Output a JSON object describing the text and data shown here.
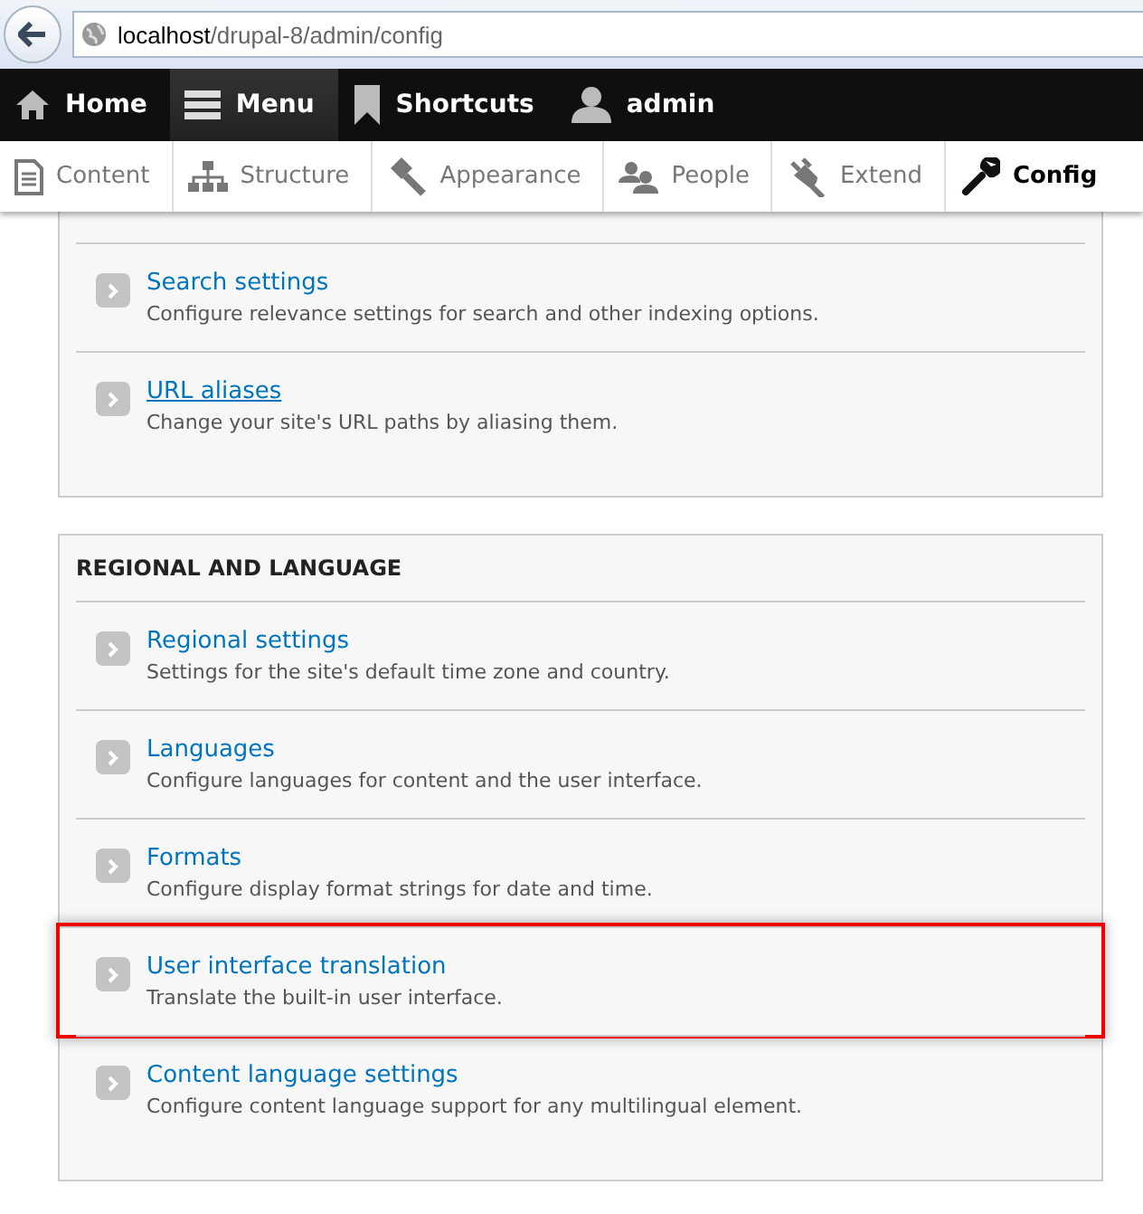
{
  "address_bar": {
    "host": "localhost",
    "path": "/drupal-8/admin/config"
  },
  "toolbar": [
    {
      "kind": "home",
      "label": "Home",
      "selected": false
    },
    {
      "kind": "menu",
      "label": "Menu",
      "selected": true
    },
    {
      "kind": "shortcuts",
      "label": "Shortcuts",
      "selected": false
    },
    {
      "kind": "user",
      "label": "admin",
      "selected": false
    }
  ],
  "tray": [
    {
      "kind": "content",
      "label": "Content",
      "selected": false
    },
    {
      "kind": "structure",
      "label": "Structure",
      "selected": false
    },
    {
      "kind": "appearance",
      "label": "Appearance",
      "selected": false
    },
    {
      "kind": "people",
      "label": "People",
      "selected": false
    },
    {
      "kind": "extend",
      "label": "Extend",
      "selected": false
    },
    {
      "kind": "config",
      "label": "Config",
      "selected": true
    }
  ],
  "panels": [
    {
      "items": [
        {
          "title": "Search settings",
          "description": "Configure relevance settings for search and other indexing options.",
          "hovered": false,
          "highlighted": false
        },
        {
          "title": "URL aliases",
          "description": "Change your site's URL paths by aliasing them.",
          "hovered": true,
          "highlighted": false
        }
      ]
    },
    {
      "heading": "REGIONAL AND LANGUAGE",
      "items": [
        {
          "title": "Regional settings",
          "description": "Settings for the site's default time zone and country.",
          "hovered": false,
          "highlighted": false
        },
        {
          "title": "Languages",
          "description": "Configure languages for content and the user interface.",
          "hovered": false,
          "highlighted": false
        },
        {
          "title": "Formats",
          "description": "Configure display format strings for date and time.",
          "hovered": false,
          "highlighted": false
        },
        {
          "title": "User interface translation",
          "description": "Translate the built-in user interface.",
          "hovered": false,
          "highlighted": true
        },
        {
          "title": "Content language settings",
          "description": "Configure content language support for any multilingual element.",
          "hovered": false,
          "highlighted": false
        }
      ]
    }
  ]
}
